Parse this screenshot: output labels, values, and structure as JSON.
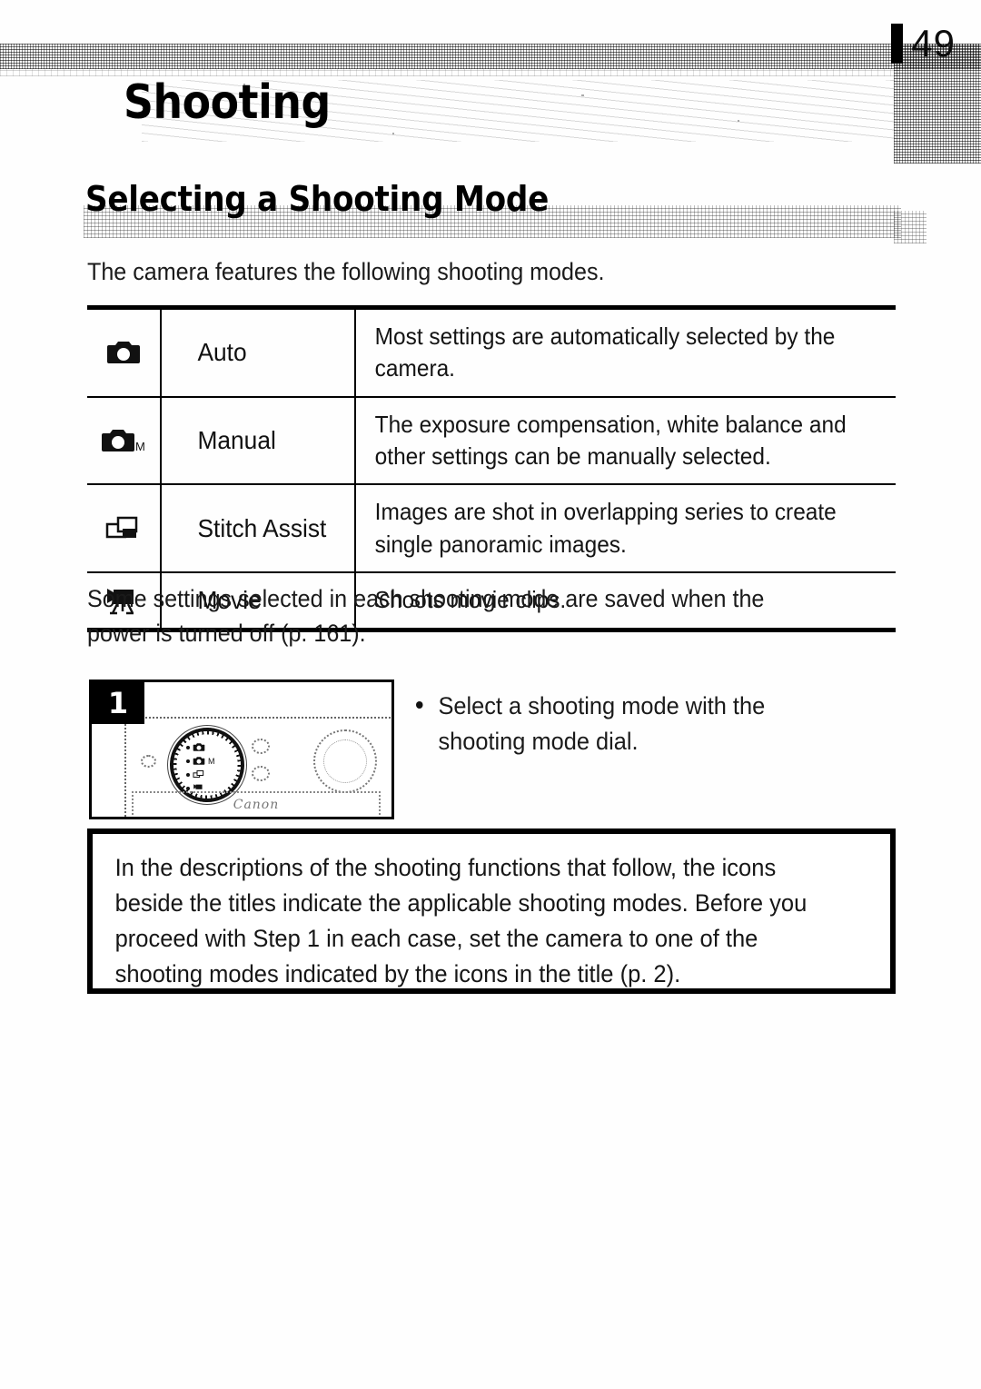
{
  "page": {
    "number": "49",
    "chapter_title": "Shooting",
    "section_title": "Selecting a Shooting Mode"
  },
  "intro": {
    "text": "The camera features the following shooting modes."
  },
  "mode_table": {
    "rows": [
      {
        "icon": "camera-auto-icon",
        "name": "Auto",
        "description": "Most settings are automatically selected by the camera."
      },
      {
        "icon": "camera-manual-icon",
        "name": "Manual",
        "description": "The exposure compensation, white balance and other settings can be manually selected."
      },
      {
        "icon": "stitch-assist-icon",
        "name": "Stitch Assist",
        "description": "Images are shot in overlapping series to create single panoramic images."
      },
      {
        "icon": "movie-camera-icon",
        "name": "Movie",
        "description": "Shoots movie clips."
      }
    ]
  },
  "saved_settings": {
    "text": "Some settings selected in each shooting mode are saved when the power is turned off (p. 161)."
  },
  "step": {
    "badge": "1",
    "bullet": "Select a shooting mode with the shooting mode dial.",
    "illustration": {
      "brand": "Canon",
      "caption": "camera-mode-dial-photo"
    }
  },
  "note": {
    "text": "In the descriptions of the shooting functions that follow, the icons beside the titles indicate the applicable shooting modes. Before you proceed with Step 1 in each case, set the camera to one of the shooting modes indicated by the icons in the title (p. 2)."
  },
  "colors": {
    "ink": "#111111",
    "paper": "#ffffff",
    "rule": "#000000"
  }
}
